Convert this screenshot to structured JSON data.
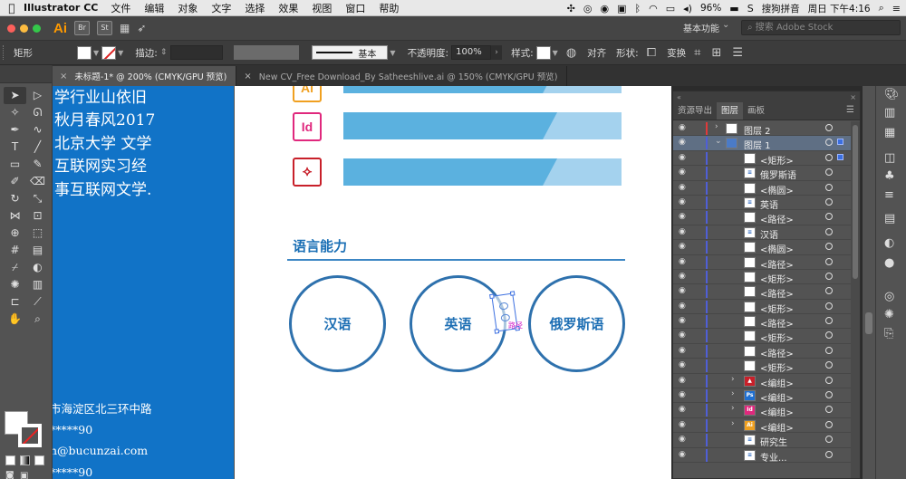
{
  "menubar": {
    "app_name": "Illustrator CC",
    "items": [
      "文件",
      "编辑",
      "对象",
      "文字",
      "选择",
      "效果",
      "视图",
      "窗口",
      "帮助"
    ],
    "battery": "96%",
    "ime": "搜狗拼音",
    "clock": "周日 下午4:16"
  },
  "appbar": {
    "logo": "Ai",
    "icons": [
      "Br",
      "St"
    ],
    "workspace": "基本功能",
    "search_placeholder": "搜索 Adobe Stock"
  },
  "control": {
    "object_type": "矩形",
    "stroke_label": "描边:",
    "line_style": "基本",
    "opacity_label": "不透明度:",
    "opacity_value": "100%",
    "style_label": "样式:",
    "align_label": "对齐",
    "shape_label": "形状:",
    "transform_label": "变换"
  },
  "tabs": [
    {
      "label": "未标题-1* @ 200% (CMYK/GPU 预览)"
    },
    {
      "label": "New CV_Free Download_By Satheeshlive.ai @ 150% (CMYK/GPU 预览)"
    }
  ],
  "artboard": {
    "left_lines": [
      "学行业山依旧",
      "秋月春风2017",
      "北京大学 文学",
      "互联网实习经",
      "事互联网文学."
    ],
    "contact_lines": [
      "市海淀区北三环中路",
      "*****90",
      "n@bucunzai.com",
      "*****90"
    ],
    "app_icons": [
      "Ai",
      "Id",
      "Acrobat"
    ],
    "section_title": "语言能力",
    "languages": [
      "汉语",
      "英语",
      "俄罗斯语"
    ],
    "selection_tag": "路径"
  },
  "layers_panel": {
    "tabs": [
      "资源导出",
      "图层",
      "画板"
    ],
    "active_tab": "图层",
    "rows": [
      {
        "name": "图层 2",
        "level": 0,
        "expander": "›",
        "thumb": "white",
        "marker": "red"
      },
      {
        "name": "图层 1",
        "level": 0,
        "expander": "⌄",
        "thumb": "blue",
        "marker": "blue",
        "highlight": true,
        "selected": true
      },
      {
        "name": "<矩形>",
        "level": 1,
        "thumb": "white",
        "selected": true
      },
      {
        "name": "俄罗斯语",
        "level": 1,
        "thumb": "text"
      },
      {
        "name": "<椭圆>",
        "level": 1,
        "thumb": "white"
      },
      {
        "name": "英语",
        "level": 1,
        "thumb": "text"
      },
      {
        "name": "<路径>",
        "level": 1,
        "thumb": "white"
      },
      {
        "name": "汉语",
        "level": 1,
        "thumb": "text"
      },
      {
        "name": "<椭圆>",
        "level": 1,
        "thumb": "white"
      },
      {
        "name": "<路径>",
        "level": 1,
        "thumb": "white"
      },
      {
        "name": "<矩形>",
        "level": 1,
        "thumb": "white"
      },
      {
        "name": "<路径>",
        "level": 1,
        "thumb": "white"
      },
      {
        "name": "<矩形>",
        "level": 1,
        "thumb": "white"
      },
      {
        "name": "<路径>",
        "level": 1,
        "thumb": "white"
      },
      {
        "name": "<矩形>",
        "level": 1,
        "thumb": "white"
      },
      {
        "name": "<路径>",
        "level": 1,
        "thumb": "white"
      },
      {
        "name": "<矩形>",
        "level": 1,
        "thumb": "white"
      },
      {
        "name": "<编组>",
        "level": 1,
        "expander": "›",
        "thumb": "pdf"
      },
      {
        "name": "<编组>",
        "level": 1,
        "expander": "›",
        "thumb": "ps"
      },
      {
        "name": "<编组>",
        "level": 1,
        "expander": "›",
        "thumb": "id"
      },
      {
        "name": "<编组>",
        "level": 1,
        "expander": "›",
        "thumb": "ai"
      },
      {
        "name": "研究生",
        "level": 1,
        "thumb": "text"
      },
      {
        "name": "专业...",
        "level": 1,
        "thumb": "text"
      }
    ]
  },
  "colors": {
    "blue_page": "#1173c7",
    "bar": "#5bb1df",
    "circle_border": "#2e71ad",
    "ai_orange": "#ff9a00",
    "id_pink": "#e0287d",
    "pdf_red": "#c8202a"
  }
}
